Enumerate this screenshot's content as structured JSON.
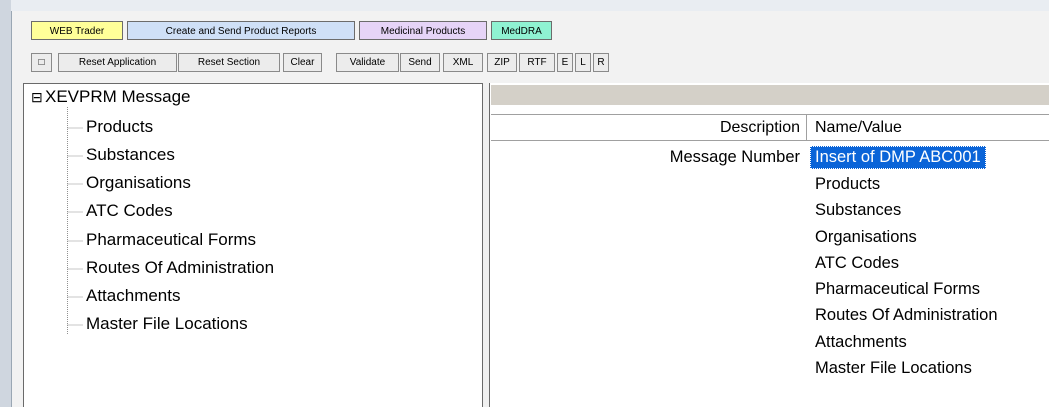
{
  "tabs": [
    {
      "label": "WEB Trader",
      "color": "#ffff99"
    },
    {
      "label": "Create and Send Product Reports",
      "color": "#cfe0f7"
    },
    {
      "label": "Medicinal Products",
      "color": "#e6d4f7"
    },
    {
      "label": "MedDRA",
      "color": "#8ff2d2"
    }
  ],
  "toolbar": {
    "checkbox_glyph": "□",
    "reset_application": "Reset Application",
    "reset_section": "Reset Section",
    "clear": "Clear",
    "validate": "Validate",
    "send": "Send",
    "xml": "XML",
    "zip": "ZIP",
    "rtf": "RTF",
    "e": "E",
    "l": "L",
    "r": "R"
  },
  "tree": {
    "root_toggle": "⊟",
    "root_label": "XEVPRM Message",
    "children": [
      "Products",
      "Substances",
      "Organisations",
      "ATC Codes",
      "Pharmaceutical Forms",
      "Routes Of Administration",
      "Attachments",
      "Master File Locations"
    ]
  },
  "grid": {
    "col_description": "Description",
    "col_name_value": "Name/Value",
    "rows": [
      {
        "description": "Message Number",
        "value": "Insert of DMP ABC001",
        "selected": true
      },
      {
        "description": "",
        "value": "Products"
      },
      {
        "description": "",
        "value": "Substances"
      },
      {
        "description": "",
        "value": "Organisations"
      },
      {
        "description": "",
        "value": "ATC Codes"
      },
      {
        "description": "",
        "value": "Pharmaceutical Forms"
      },
      {
        "description": "",
        "value": "Routes Of Administration"
      },
      {
        "description": "",
        "value": "Attachments"
      },
      {
        "description": "",
        "value": "Master File Locations"
      }
    ]
  },
  "colors": {
    "selection": "#0a64d8",
    "selection_text": "#ffffff"
  }
}
